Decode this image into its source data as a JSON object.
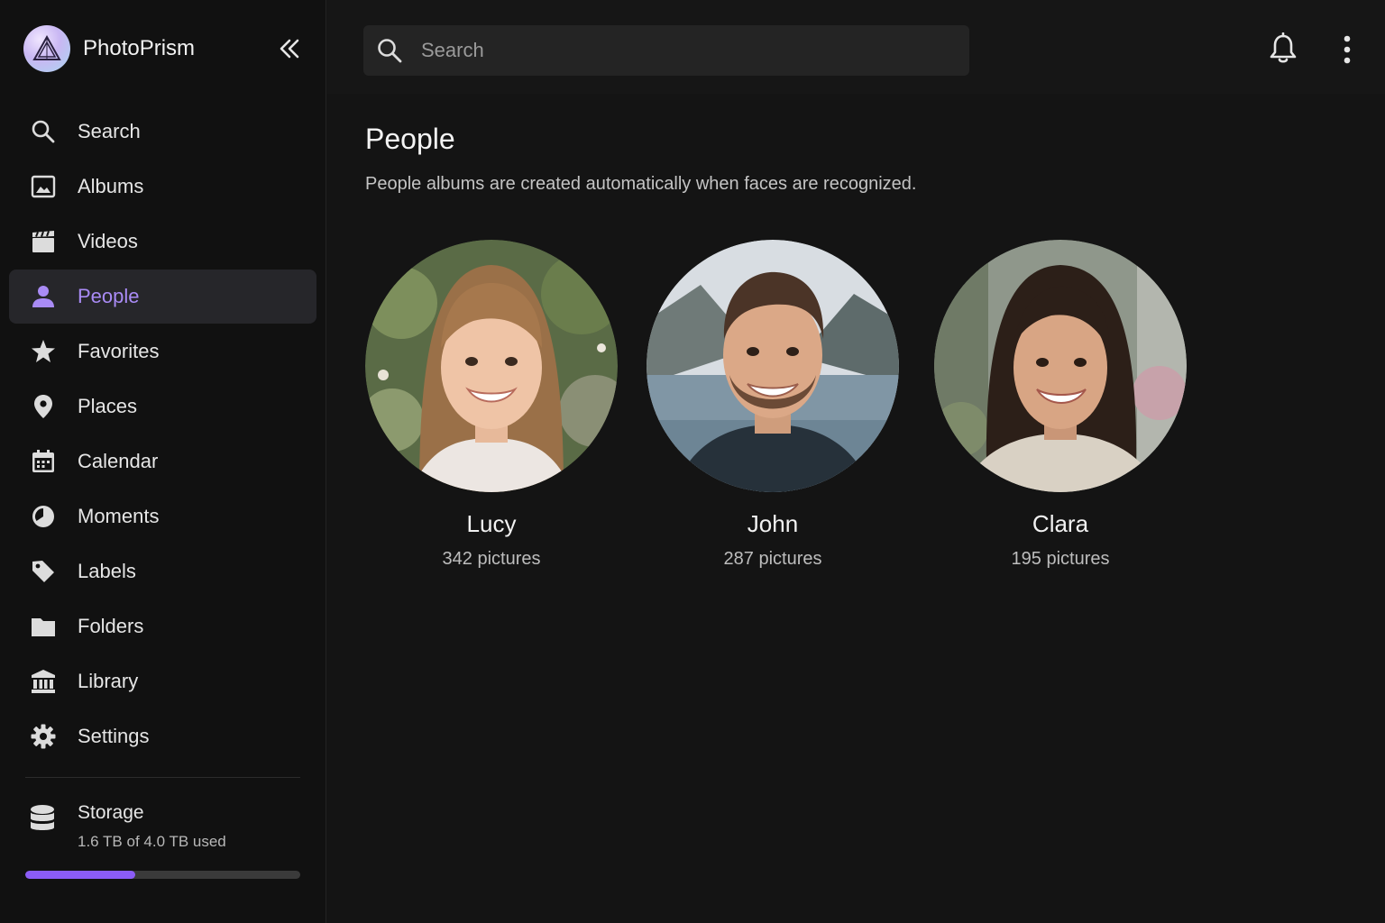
{
  "app": {
    "name": "PhotoPrism"
  },
  "sidebar": {
    "items": [
      {
        "label": "Search",
        "icon": "search-icon"
      },
      {
        "label": "Albums",
        "icon": "image-icon"
      },
      {
        "label": "Videos",
        "icon": "clapperboard-icon"
      },
      {
        "label": "People",
        "icon": "person-icon",
        "active": true
      },
      {
        "label": "Favorites",
        "icon": "star-icon"
      },
      {
        "label": "Places",
        "icon": "map-pin-icon"
      },
      {
        "label": "Calendar",
        "icon": "calendar-icon"
      },
      {
        "label": "Moments",
        "icon": "pie-icon"
      },
      {
        "label": "Labels",
        "icon": "tag-icon"
      },
      {
        "label": "Folders",
        "icon": "folder-icon"
      },
      {
        "label": "Library",
        "icon": "library-icon"
      },
      {
        "label": "Settings",
        "icon": "gear-icon"
      }
    ],
    "storage": {
      "title": "Storage",
      "used_text": "1.6 TB of 4.0 TB used",
      "fraction": 0.4
    }
  },
  "search": {
    "placeholder": "Search"
  },
  "page": {
    "title": "People",
    "subtitle": "People albums are created automatically when faces are recognized."
  },
  "people": [
    {
      "name": "Lucy",
      "count": "342 pictures"
    },
    {
      "name": "John",
      "count": "287 pictures"
    },
    {
      "name": "Clara",
      "count": "195 pictures"
    }
  ],
  "colors": {
    "accent": "#8b5cf6",
    "accent_text": "#a98bf5",
    "background": "#141414"
  }
}
